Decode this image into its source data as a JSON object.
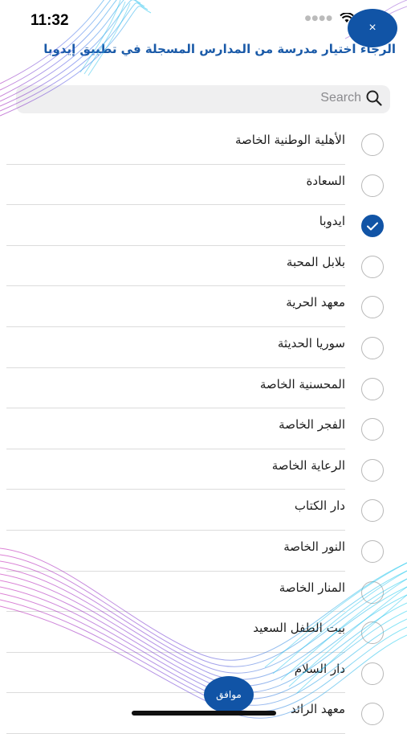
{
  "status_bar": {
    "time": "11:32"
  },
  "header": {
    "close_label": "×",
    "title": "الرجاء اختيار مدرسة من المدارس المسجلة في تطبيق إيدوبا"
  },
  "search": {
    "placeholder": "Search"
  },
  "schools": [
    {
      "name": "الأهلية الوطنية الخاصة",
      "selected": false
    },
    {
      "name": "السعادة",
      "selected": false
    },
    {
      "name": "ايدوبا",
      "selected": true
    },
    {
      "name": "بلابل المحبة",
      "selected": false
    },
    {
      "name": "معهد الحرية",
      "selected": false
    },
    {
      "name": "سوريا الحديثة",
      "selected": false
    },
    {
      "name": "المحسنية الخاصة",
      "selected": false
    },
    {
      "name": "الفجر الخاصة",
      "selected": false
    },
    {
      "name": "الرعاية الخاصة",
      "selected": false
    },
    {
      "name": "دار الكتاب",
      "selected": false
    },
    {
      "name": "النور الخاصة",
      "selected": false
    },
    {
      "name": "المنار الخاصة",
      "selected": false
    },
    {
      "name": "بيت الطفل السعيد",
      "selected": false
    },
    {
      "name": "دار السلام",
      "selected": false
    },
    {
      "name": "معهد الرائد",
      "selected": false
    }
  ],
  "footer": {
    "ok_label": "موافق"
  },
  "colors": {
    "accent": "#1154a6",
    "title": "#1a5aa8",
    "divider": "#dcdcdc"
  },
  "icons": [
    "search-icon",
    "check-icon",
    "close-icon",
    "wifi-icon",
    "battery-icon"
  ]
}
